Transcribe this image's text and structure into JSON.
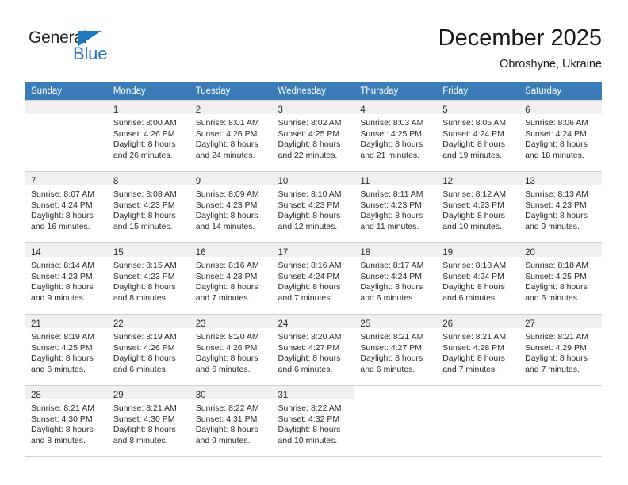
{
  "brand": {
    "name_top": "General",
    "name_bottom": "Blue",
    "accent_color": "#1f77bd"
  },
  "header": {
    "title": "December 2025",
    "subtitle": "Obroshyne, Ukraine"
  },
  "theme": {
    "header_row_bg": "#3b7cb8",
    "daynum_band_bg": "#f0f0f0",
    "grid_border": "#cfcfcf",
    "text_color": "#2b2b2b"
  },
  "weekday_headers": [
    "Sunday",
    "Monday",
    "Tuesday",
    "Wednesday",
    "Thursday",
    "Friday",
    "Saturday"
  ],
  "weeks": [
    [
      {
        "day": "",
        "lines": []
      },
      {
        "day": "1",
        "lines": [
          "Sunrise: 8:00 AM",
          "Sunset: 4:26 PM",
          "Daylight: 8 hours",
          "and 26 minutes."
        ]
      },
      {
        "day": "2",
        "lines": [
          "Sunrise: 8:01 AM",
          "Sunset: 4:26 PM",
          "Daylight: 8 hours",
          "and 24 minutes."
        ]
      },
      {
        "day": "3",
        "lines": [
          "Sunrise: 8:02 AM",
          "Sunset: 4:25 PM",
          "Daylight: 8 hours",
          "and 22 minutes."
        ]
      },
      {
        "day": "4",
        "lines": [
          "Sunrise: 8:03 AM",
          "Sunset: 4:25 PM",
          "Daylight: 8 hours",
          "and 21 minutes."
        ]
      },
      {
        "day": "5",
        "lines": [
          "Sunrise: 8:05 AM",
          "Sunset: 4:24 PM",
          "Daylight: 8 hours",
          "and 19 minutes."
        ]
      },
      {
        "day": "6",
        "lines": [
          "Sunrise: 8:06 AM",
          "Sunset: 4:24 PM",
          "Daylight: 8 hours",
          "and 18 minutes."
        ]
      }
    ],
    [
      {
        "day": "7",
        "lines": [
          "Sunrise: 8:07 AM",
          "Sunset: 4:24 PM",
          "Daylight: 8 hours",
          "and 16 minutes."
        ]
      },
      {
        "day": "8",
        "lines": [
          "Sunrise: 8:08 AM",
          "Sunset: 4:23 PM",
          "Daylight: 8 hours",
          "and 15 minutes."
        ]
      },
      {
        "day": "9",
        "lines": [
          "Sunrise: 8:09 AM",
          "Sunset: 4:23 PM",
          "Daylight: 8 hours",
          "and 14 minutes."
        ]
      },
      {
        "day": "10",
        "lines": [
          "Sunrise: 8:10 AM",
          "Sunset: 4:23 PM",
          "Daylight: 8 hours",
          "and 12 minutes."
        ]
      },
      {
        "day": "11",
        "lines": [
          "Sunrise: 8:11 AM",
          "Sunset: 4:23 PM",
          "Daylight: 8 hours",
          "and 11 minutes."
        ]
      },
      {
        "day": "12",
        "lines": [
          "Sunrise: 8:12 AM",
          "Sunset: 4:23 PM",
          "Daylight: 8 hours",
          "and 10 minutes."
        ]
      },
      {
        "day": "13",
        "lines": [
          "Sunrise: 8:13 AM",
          "Sunset: 4:23 PM",
          "Daylight: 8 hours",
          "and 9 minutes."
        ]
      }
    ],
    [
      {
        "day": "14",
        "lines": [
          "Sunrise: 8:14 AM",
          "Sunset: 4:23 PM",
          "Daylight: 8 hours",
          "and 9 minutes."
        ]
      },
      {
        "day": "15",
        "lines": [
          "Sunrise: 8:15 AM",
          "Sunset: 4:23 PM",
          "Daylight: 8 hours",
          "and 8 minutes."
        ]
      },
      {
        "day": "16",
        "lines": [
          "Sunrise: 8:16 AM",
          "Sunset: 4:23 PM",
          "Daylight: 8 hours",
          "and 7 minutes."
        ]
      },
      {
        "day": "17",
        "lines": [
          "Sunrise: 8:16 AM",
          "Sunset: 4:24 PM",
          "Daylight: 8 hours",
          "and 7 minutes."
        ]
      },
      {
        "day": "18",
        "lines": [
          "Sunrise: 8:17 AM",
          "Sunset: 4:24 PM",
          "Daylight: 8 hours",
          "and 6 minutes."
        ]
      },
      {
        "day": "19",
        "lines": [
          "Sunrise: 8:18 AM",
          "Sunset: 4:24 PM",
          "Daylight: 8 hours",
          "and 6 minutes."
        ]
      },
      {
        "day": "20",
        "lines": [
          "Sunrise: 8:18 AM",
          "Sunset: 4:25 PM",
          "Daylight: 8 hours",
          "and 6 minutes."
        ]
      }
    ],
    [
      {
        "day": "21",
        "lines": [
          "Sunrise: 8:19 AM",
          "Sunset: 4:25 PM",
          "Daylight: 8 hours",
          "and 6 minutes."
        ]
      },
      {
        "day": "22",
        "lines": [
          "Sunrise: 8:19 AM",
          "Sunset: 4:26 PM",
          "Daylight: 8 hours",
          "and 6 minutes."
        ]
      },
      {
        "day": "23",
        "lines": [
          "Sunrise: 8:20 AM",
          "Sunset: 4:26 PM",
          "Daylight: 8 hours",
          "and 6 minutes."
        ]
      },
      {
        "day": "24",
        "lines": [
          "Sunrise: 8:20 AM",
          "Sunset: 4:27 PM",
          "Daylight: 8 hours",
          "and 6 minutes."
        ]
      },
      {
        "day": "25",
        "lines": [
          "Sunrise: 8:21 AM",
          "Sunset: 4:27 PM",
          "Daylight: 8 hours",
          "and 6 minutes."
        ]
      },
      {
        "day": "26",
        "lines": [
          "Sunrise: 8:21 AM",
          "Sunset: 4:28 PM",
          "Daylight: 8 hours",
          "and 7 minutes."
        ]
      },
      {
        "day": "27",
        "lines": [
          "Sunrise: 8:21 AM",
          "Sunset: 4:29 PM",
          "Daylight: 8 hours",
          "and 7 minutes."
        ]
      }
    ],
    [
      {
        "day": "28",
        "lines": [
          "Sunrise: 8:21 AM",
          "Sunset: 4:30 PM",
          "Daylight: 8 hours",
          "and 8 minutes."
        ]
      },
      {
        "day": "29",
        "lines": [
          "Sunrise: 8:21 AM",
          "Sunset: 4:30 PM",
          "Daylight: 8 hours",
          "and 8 minutes."
        ]
      },
      {
        "day": "30",
        "lines": [
          "Sunrise: 8:22 AM",
          "Sunset: 4:31 PM",
          "Daylight: 8 hours",
          "and 9 minutes."
        ]
      },
      {
        "day": "31",
        "lines": [
          "Sunrise: 8:22 AM",
          "Sunset: 4:32 PM",
          "Daylight: 8 hours",
          "and 10 minutes."
        ]
      },
      {
        "day": "",
        "lines": []
      },
      {
        "day": "",
        "lines": []
      },
      {
        "day": "",
        "lines": []
      }
    ]
  ]
}
